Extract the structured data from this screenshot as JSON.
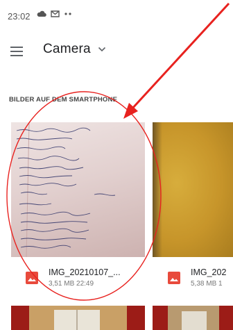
{
  "status_bar": {
    "time": "23:02",
    "icons": [
      "cloud-icon",
      "gmail-icon",
      "more-dots-icon"
    ]
  },
  "app_bar": {
    "menu_icon": "hamburger-menu-icon",
    "title": "Camera",
    "dropdown_icon": "chevron-down-icon"
  },
  "section": {
    "header": "BILDER AUF DEM SMARTPHONE"
  },
  "files": [
    {
      "name": "IMG_20210107_...",
      "size_time": "3,51 MB 22:49",
      "icon": "image-file-icon",
      "thumbnail": "handwritten-notes-photo"
    },
    {
      "name": "IMG_202",
      "size_time": "5,38 MB 1",
      "icon": "image-file-icon",
      "thumbnail": "yellow-wall-photo"
    }
  ],
  "colors": {
    "accent_icon": "#e84a3c",
    "annotation": "#e8221f",
    "text_primary": "#202124",
    "text_secondary": "#777777"
  }
}
